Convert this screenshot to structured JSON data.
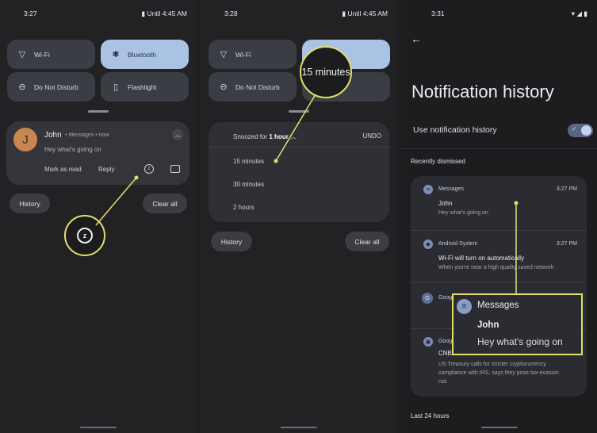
{
  "colors": {
    "accent": "#e2df6a",
    "tile_on": "#aac3e5",
    "tile_off": "#3b3d45",
    "avatar": "#c88650"
  },
  "panel1": {
    "status": {
      "time": "3:27",
      "right": "Until 4:45 AM"
    },
    "tiles": [
      {
        "label": "Wi-Fi",
        "icon": "wifi-icon",
        "glyph": "▽"
      },
      {
        "label": "Bluetooth",
        "icon": "bluetooth-icon",
        "glyph": "✱"
      },
      {
        "label": "Do Not Disturb",
        "icon": "do-not-disturb-icon",
        "glyph": "⊖"
      },
      {
        "label": "Flashlight",
        "icon": "flashlight-icon",
        "glyph": "▯"
      }
    ],
    "notification": {
      "avatar_letter": "J",
      "name": "John",
      "meta": "Messages",
      "time": "now",
      "text": "Hey what's going on",
      "actions": [
        "Mark as read",
        "Reply"
      ]
    },
    "history": "History",
    "clear_all": "Clear all"
  },
  "panel2": {
    "status": {
      "time": "3:28",
      "right": "Until 4:45 AM"
    },
    "tiles": [
      "Wi-Fi",
      "Bluetooth",
      "Do Not Disturb",
      "Flashlight"
    ],
    "callout_text": "15 minutes",
    "snooze": {
      "header_prefix": "Snoozed for",
      "header_value": "1 hour",
      "undo": "UNDO",
      "options": [
        "15 minutes",
        "30 minutes",
        "2 hours"
      ]
    },
    "history": "History",
    "clear_all": "Clear all"
  },
  "panel3": {
    "status": {
      "time": "3:31"
    },
    "title": "Notification history",
    "toggle_label": "Use notification history",
    "toggle_on": true,
    "recently_dismissed": "Recently dismissed",
    "items": [
      {
        "app": "Messages",
        "time": "3:27 PM",
        "title": "John",
        "text": "Hey what's going on"
      },
      {
        "app": "Android System",
        "time": "3:27 PM",
        "title": "Wi-Fi will turn on automatically",
        "text": "When you're near a high quality saved network"
      },
      {
        "app": "Goog",
        "time": "",
        "title": "",
        "text": ""
      },
      {
        "app": "Goog",
        "time": "",
        "title": "CNB",
        "text": "US Treasury calls for stricter cryptocurrency compliance with IRS, says they pose tax-evasion risk"
      }
    ],
    "zoom": {
      "app": "Messages",
      "title": "John",
      "text": "Hey what's going on"
    },
    "last_24": "Last 24 hours"
  }
}
